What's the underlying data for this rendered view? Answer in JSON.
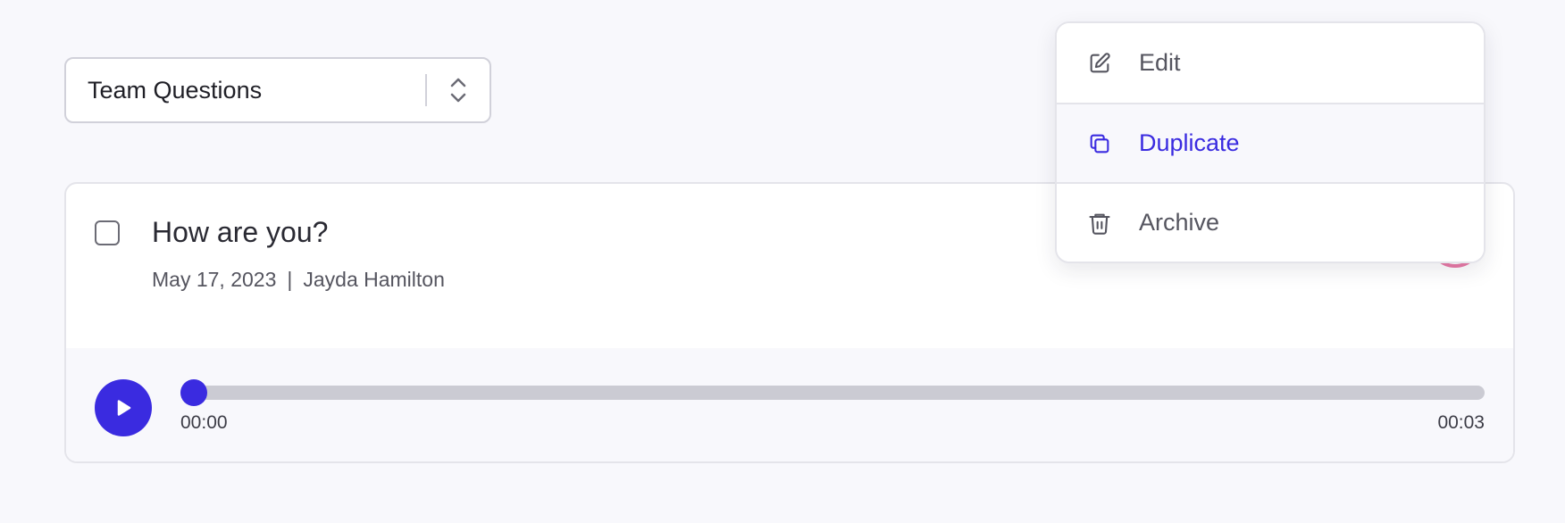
{
  "select": {
    "value": "Team Questions",
    "icon": "chevron-up-down-icon"
  },
  "question": {
    "title": "How are you?",
    "date": "May 17, 2023",
    "separator": "|",
    "author": "Jayda Hamilton",
    "checked": false
  },
  "player": {
    "play_icon": "play-icon",
    "current_time": "00:00",
    "duration": "00:03",
    "progress": 0.0
  },
  "menu": {
    "items": [
      {
        "label": "Edit",
        "icon": "pencil-square-icon",
        "active": false
      },
      {
        "label": "Duplicate",
        "icon": "duplicate-icon",
        "active": true
      },
      {
        "label": "Archive",
        "icon": "trash-icon",
        "active": false
      }
    ]
  },
  "colors": {
    "accent": "#3a2be0",
    "avatar_ring": "#e87aa6",
    "background": "#f8f8fc",
    "border": "#e4e4ea",
    "muted_text": "#55555f",
    "track": "#cbcbd3"
  }
}
